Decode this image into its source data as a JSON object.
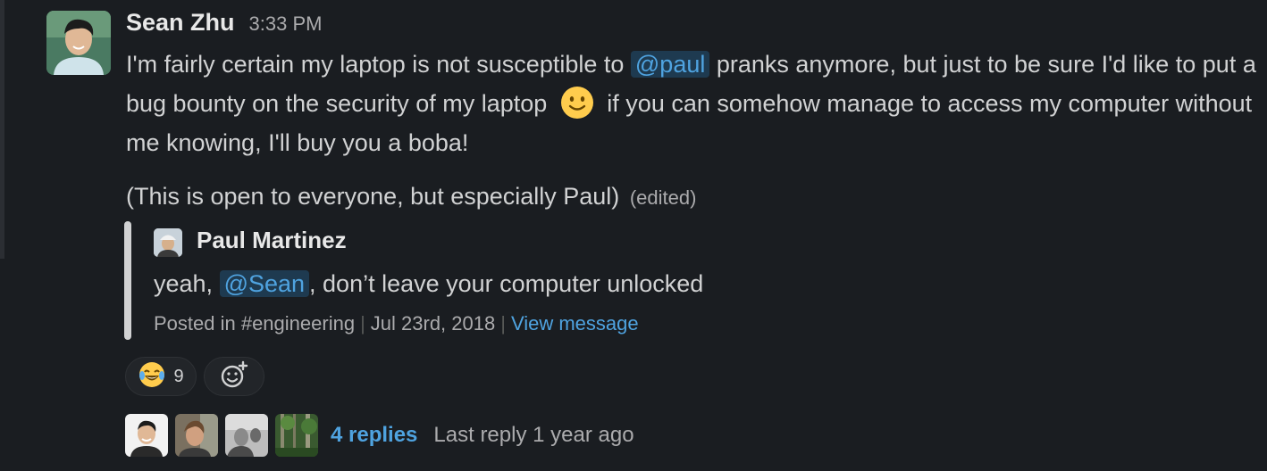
{
  "message": {
    "author": "Sean Zhu",
    "time": "3:33 PM",
    "text_part1": "I'm fairly certain my laptop is not susceptible to ",
    "mention1": "@paul",
    "text_part2": " pranks anymore, but just to be sure I'd like to put a bug bounty on the security of my laptop ",
    "emoji1": "slightly-smiling-face",
    "text_part3": "  if you can somehow manage to access my computer without me knowing, I'll buy you a boba!",
    "paragraph2": "(This is open to everyone, but especially Paul)",
    "edited_label": "(edited)"
  },
  "shared_message": {
    "author": "Paul Martinez",
    "text_prefix": "yeah, ",
    "mention": "@Sean",
    "text_suffix": ", don’t leave your computer unlocked",
    "posted_in": "Posted in #engineering",
    "date": "Jul 23rd, 2018",
    "view_link": "View message"
  },
  "reactions": [
    {
      "emoji": "joy-icon",
      "count": "9"
    },
    {
      "emoji": "add-reaction-icon"
    }
  ],
  "thread": {
    "replies": "4 replies",
    "last_reply": "Last reply 1 year ago"
  },
  "colors": {
    "background": "#1a1d21",
    "link": "#4fa3e0",
    "mention_bg": "#1e3a50",
    "muted": "#ababad",
    "text": "#d1d2d3"
  }
}
